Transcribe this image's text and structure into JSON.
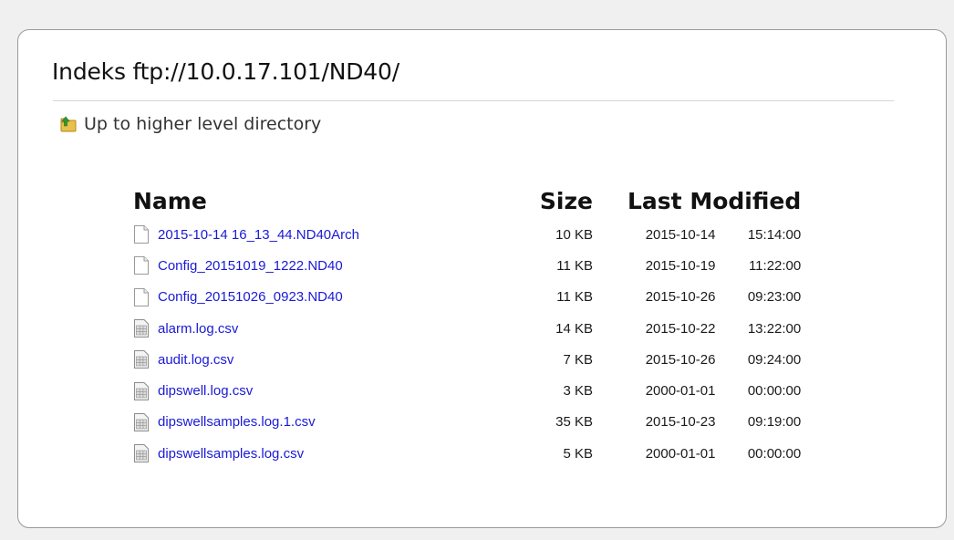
{
  "title": "Indeks ftp://10.0.17.101/ND40/",
  "parent_link": {
    "label": "Up to higher level directory",
    "icon": "folder-up-icon"
  },
  "columns": {
    "name": "Name",
    "size": "Size",
    "modified": "Last Modified"
  },
  "files": [
    {
      "name": "2015-10-14 16_13_44.ND40Arch",
      "size": "10 KB",
      "date": "2015-10-14",
      "time": "15:14:00",
      "icon": "file-icon"
    },
    {
      "name": "Config_20151019_1222.ND40",
      "size": "11 KB",
      "date": "2015-10-19",
      "time": "11:22:00",
      "icon": "file-icon"
    },
    {
      "name": "Config_20151026_0923.ND40",
      "size": "11 KB",
      "date": "2015-10-26",
      "time": "09:23:00",
      "icon": "file-icon"
    },
    {
      "name": "alarm.log.csv",
      "size": "14 KB",
      "date": "2015-10-22",
      "time": "13:22:00",
      "icon": "spreadsheet-file-icon"
    },
    {
      "name": "audit.log.csv",
      "size": "7 KB",
      "date": "2015-10-26",
      "time": "09:24:00",
      "icon": "spreadsheet-file-icon"
    },
    {
      "name": "dipswell.log.csv",
      "size": "3 KB",
      "date": "2000-01-01",
      "time": "00:00:00",
      "icon": "spreadsheet-file-icon"
    },
    {
      "name": "dipswellsamples.log.1.csv",
      "size": "35 KB",
      "date": "2015-10-23",
      "time": "09:19:00",
      "icon": "spreadsheet-file-icon"
    },
    {
      "name": "dipswellsamples.log.csv",
      "size": "5 KB",
      "date": "2000-01-01",
      "time": "00:00:00",
      "icon": "spreadsheet-file-icon"
    }
  ],
  "colors": {
    "link": "#1a1ad6",
    "text": "#111111",
    "background": "#f0f0f0",
    "panel": "#ffffff"
  }
}
